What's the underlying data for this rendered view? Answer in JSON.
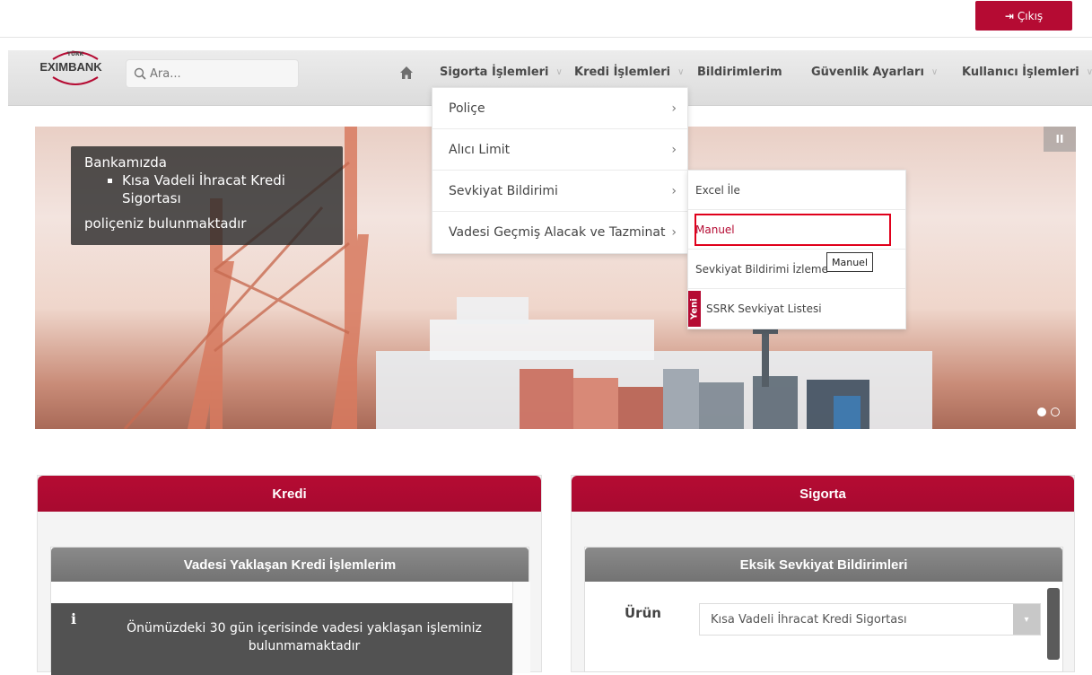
{
  "topbar": {
    "logout_label": "Çıkış"
  },
  "logo": {
    "text": "EXIMBANK",
    "small": "TÜRK"
  },
  "search": {
    "placeholder": "Ara..."
  },
  "nav": {
    "items": [
      {
        "label": "Sigorta İşlemleri"
      },
      {
        "label": "Kredi İşlemleri"
      },
      {
        "label": "Bildirimlerim"
      },
      {
        "label": "Güvenlik Ayarları"
      },
      {
        "label": "Kullanıcı İşlemleri"
      }
    ]
  },
  "hero": {
    "line1": "Bankamızda",
    "bullet": "Kısa Vadeli İhracat Kredi Sigortası",
    "line2": "poliçeniz bulunmaktadır",
    "pause_label": "II"
  },
  "menu1": {
    "items": [
      {
        "label": "Poliçe"
      },
      {
        "label": "Alıcı Limit"
      },
      {
        "label": "Sevkiyat Bildirimi"
      },
      {
        "label": "Vadesi Geçmiş Alacak ve Tazminat"
      }
    ]
  },
  "menu2": {
    "items": [
      {
        "label": "Excel İle"
      },
      {
        "label": "Manuel"
      },
      {
        "label": "Sevkiyat Bildirimi İzleme"
      },
      {
        "label": "SSRK Sevkiyat Listesi",
        "badge": "Yeni"
      }
    ]
  },
  "tooltip": {
    "text": "Manuel"
  },
  "panels": {
    "kredi": {
      "title": "Kredi",
      "sub_title": "Vadesi Yaklaşan Kredi İşlemlerim",
      "notice": "Önümüzdeki 30 gün içerisinde vadesi yaklaşan işleminiz bulunmamaktadır"
    },
    "sigorta": {
      "title": "Sigorta",
      "sub_title": "Eksik Sevkiyat Bildirimleri",
      "field_label": "Ürün",
      "field_value": "Kısa Vadeli İhracat Kredi Sigortası"
    }
  },
  "colors": {
    "brand": "#b50b33",
    "highlight": "#e0001b",
    "sub_head": "#7d7d7d"
  }
}
